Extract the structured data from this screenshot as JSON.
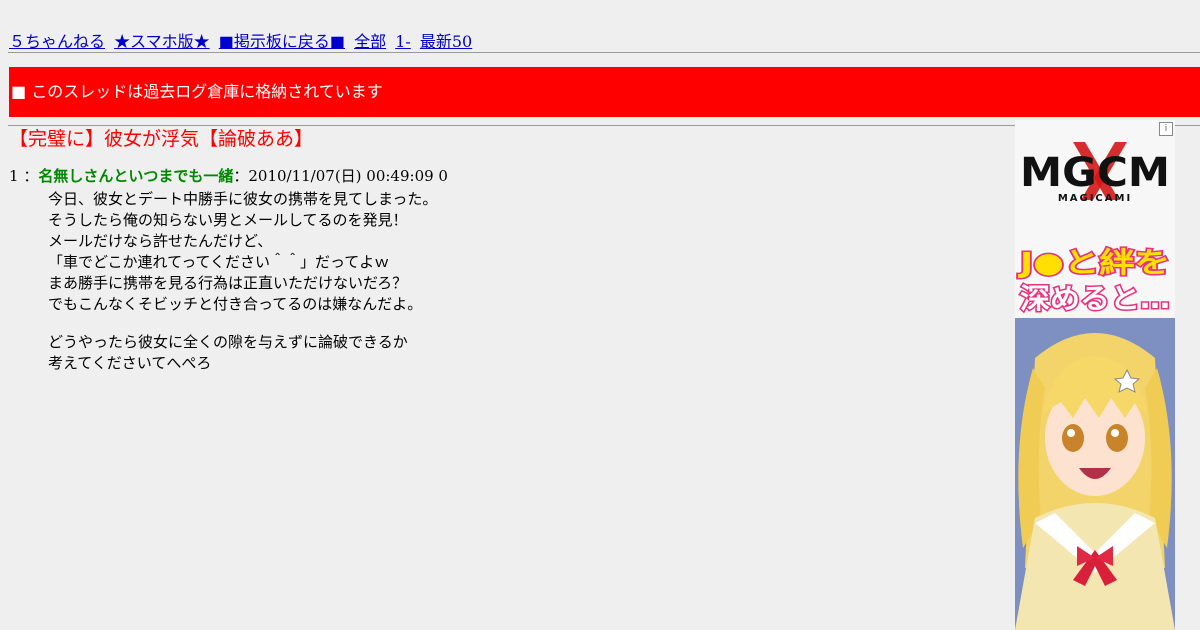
{
  "nav": {
    "items": [
      "５ちゃんねる",
      "★スマホ版★",
      "■掲示板に戻る■",
      "全部",
      "1-",
      "最新50"
    ]
  },
  "banner": {
    "text": "■ このスレッドは過去ログ倉庫に格納されています"
  },
  "thread": {
    "title": "【完璧に】彼女が浮気【論破ああ】"
  },
  "post": {
    "number": "1",
    "separator": "：",
    "name": "名無しさんといつまでも一緒",
    "datetime": "：2010/11/07(日) 00:49:09 0",
    "lines": [
      "今日、彼女とデート中勝手に彼女の携帯を見てしまった。",
      "そうしたら俺の知らない男とメールしてるのを発見！",
      "メールだけなら許せたんだけど、",
      "「車でどこか連れてってください＾＾」だってよｗ",
      "まあ勝手に携帯を見る行為は正直いただけないだろ？",
      "でもこんなくそビッチと付き合ってるのは嫌なんだよ。",
      "",
      "どうやったら彼女に全くの隙を与えずに論破できるか",
      "考えてくださいてへぺろ"
    ]
  },
  "ad": {
    "logo": "MGCM",
    "logo_sub": "MAGICAMI",
    "badge": "i",
    "tagline_1": "J●と絆を",
    "tagline_2": "深めると…"
  }
}
